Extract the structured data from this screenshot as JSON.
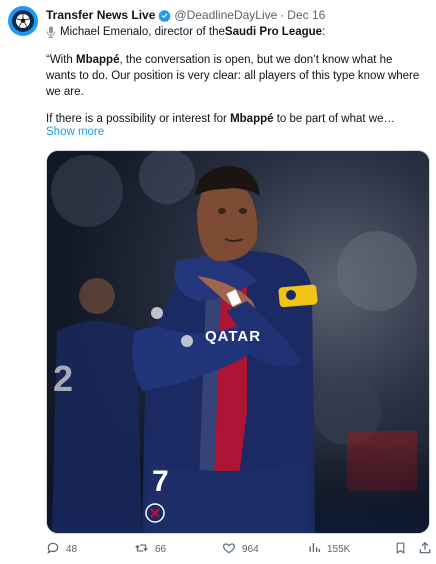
{
  "author": {
    "name": "Transfer News Live",
    "handle": "@DeadlineDayLive",
    "separator": "·",
    "date": "Dec 16"
  },
  "tweet": {
    "line1": {
      "prefix": "Michael Emenalo, director of the ",
      "bold": "Saudi Pro League",
      "suffix": ":"
    },
    "para2": {
      "part1": "“With ",
      "bold1": "Mbappé",
      "part2": ", the conversation is open, but we don’t know what he wants to do. Our position is very clear: all players of this type know where we are."
    },
    "para3": {
      "part1": "If there is a possibility or interest for ",
      "bold1": "Mbappé",
      "part2": " to be part of what we…"
    },
    "show_more": "Show more"
  },
  "media": {
    "shirt_sponsor": "QATAR",
    "shirt_number": "7",
    "bg_player_number": "2",
    "colors": {
      "shirt": "#1b2a63",
      "armband": "#f2c416",
      "stripe": "#c8102e"
    }
  },
  "actions": {
    "replies": "48",
    "retweets": "66",
    "likes": "964",
    "views": "155K"
  },
  "icons": [
    "avatar-logo",
    "verified-badge-icon",
    "microphone-icon",
    "reply-icon",
    "retweet-icon",
    "like-icon",
    "views-icon",
    "bookmark-icon",
    "share-icon"
  ]
}
